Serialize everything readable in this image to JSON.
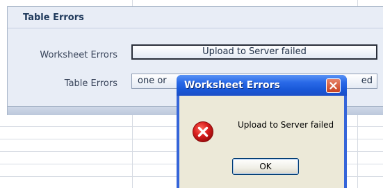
{
  "panel": {
    "title": "Table Errors",
    "rows": [
      {
        "label": "Worksheet Errors",
        "value": "Upload to Server failed"
      },
      {
        "label": "Table Errors",
        "value_left": "one or",
        "value_right": "ed"
      }
    ]
  },
  "dialog": {
    "title": "Worksheet Errors",
    "message": "Upload to Server failed",
    "ok_label": "OK",
    "icon": "error-icon",
    "close_icon": "close-icon"
  },
  "colors": {
    "titlebar": "#1958d8",
    "panel_bg": "#e8edf6",
    "error_red": "#c8101c"
  }
}
